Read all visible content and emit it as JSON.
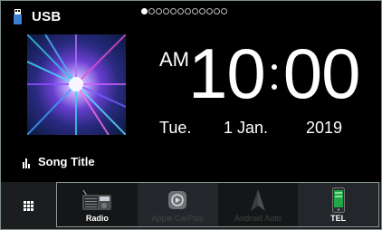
{
  "header": {
    "source_title": "USB",
    "source_icon": "usb-stick-icon",
    "page_count": 12,
    "active_page": 1
  },
  "clock": {
    "ampm": "AM",
    "hours": "10",
    "minutes": "00",
    "day_of_week": "Tue.",
    "day": "1 Jan.",
    "year": "2019"
  },
  "now_playing": {
    "song_title": "Song Title",
    "level_icon": "audio-level-icon"
  },
  "menu": {
    "icon": "grid-menu-icon"
  },
  "shortcuts": [
    {
      "label": "Radio",
      "icon": "radio-icon",
      "enabled": true
    },
    {
      "label": "Apple CarPlay",
      "icon": "carplay-icon",
      "enabled": false
    },
    {
      "label": "Android Auto",
      "icon": "android-auto-icon",
      "enabled": false
    },
    {
      "label": "TEL",
      "icon": "phone-icon",
      "enabled": true
    }
  ],
  "colors": {
    "background": "#000000",
    "bar": "#1b1d1f",
    "frame": "#8a9896",
    "disabled_text": "#444444"
  }
}
